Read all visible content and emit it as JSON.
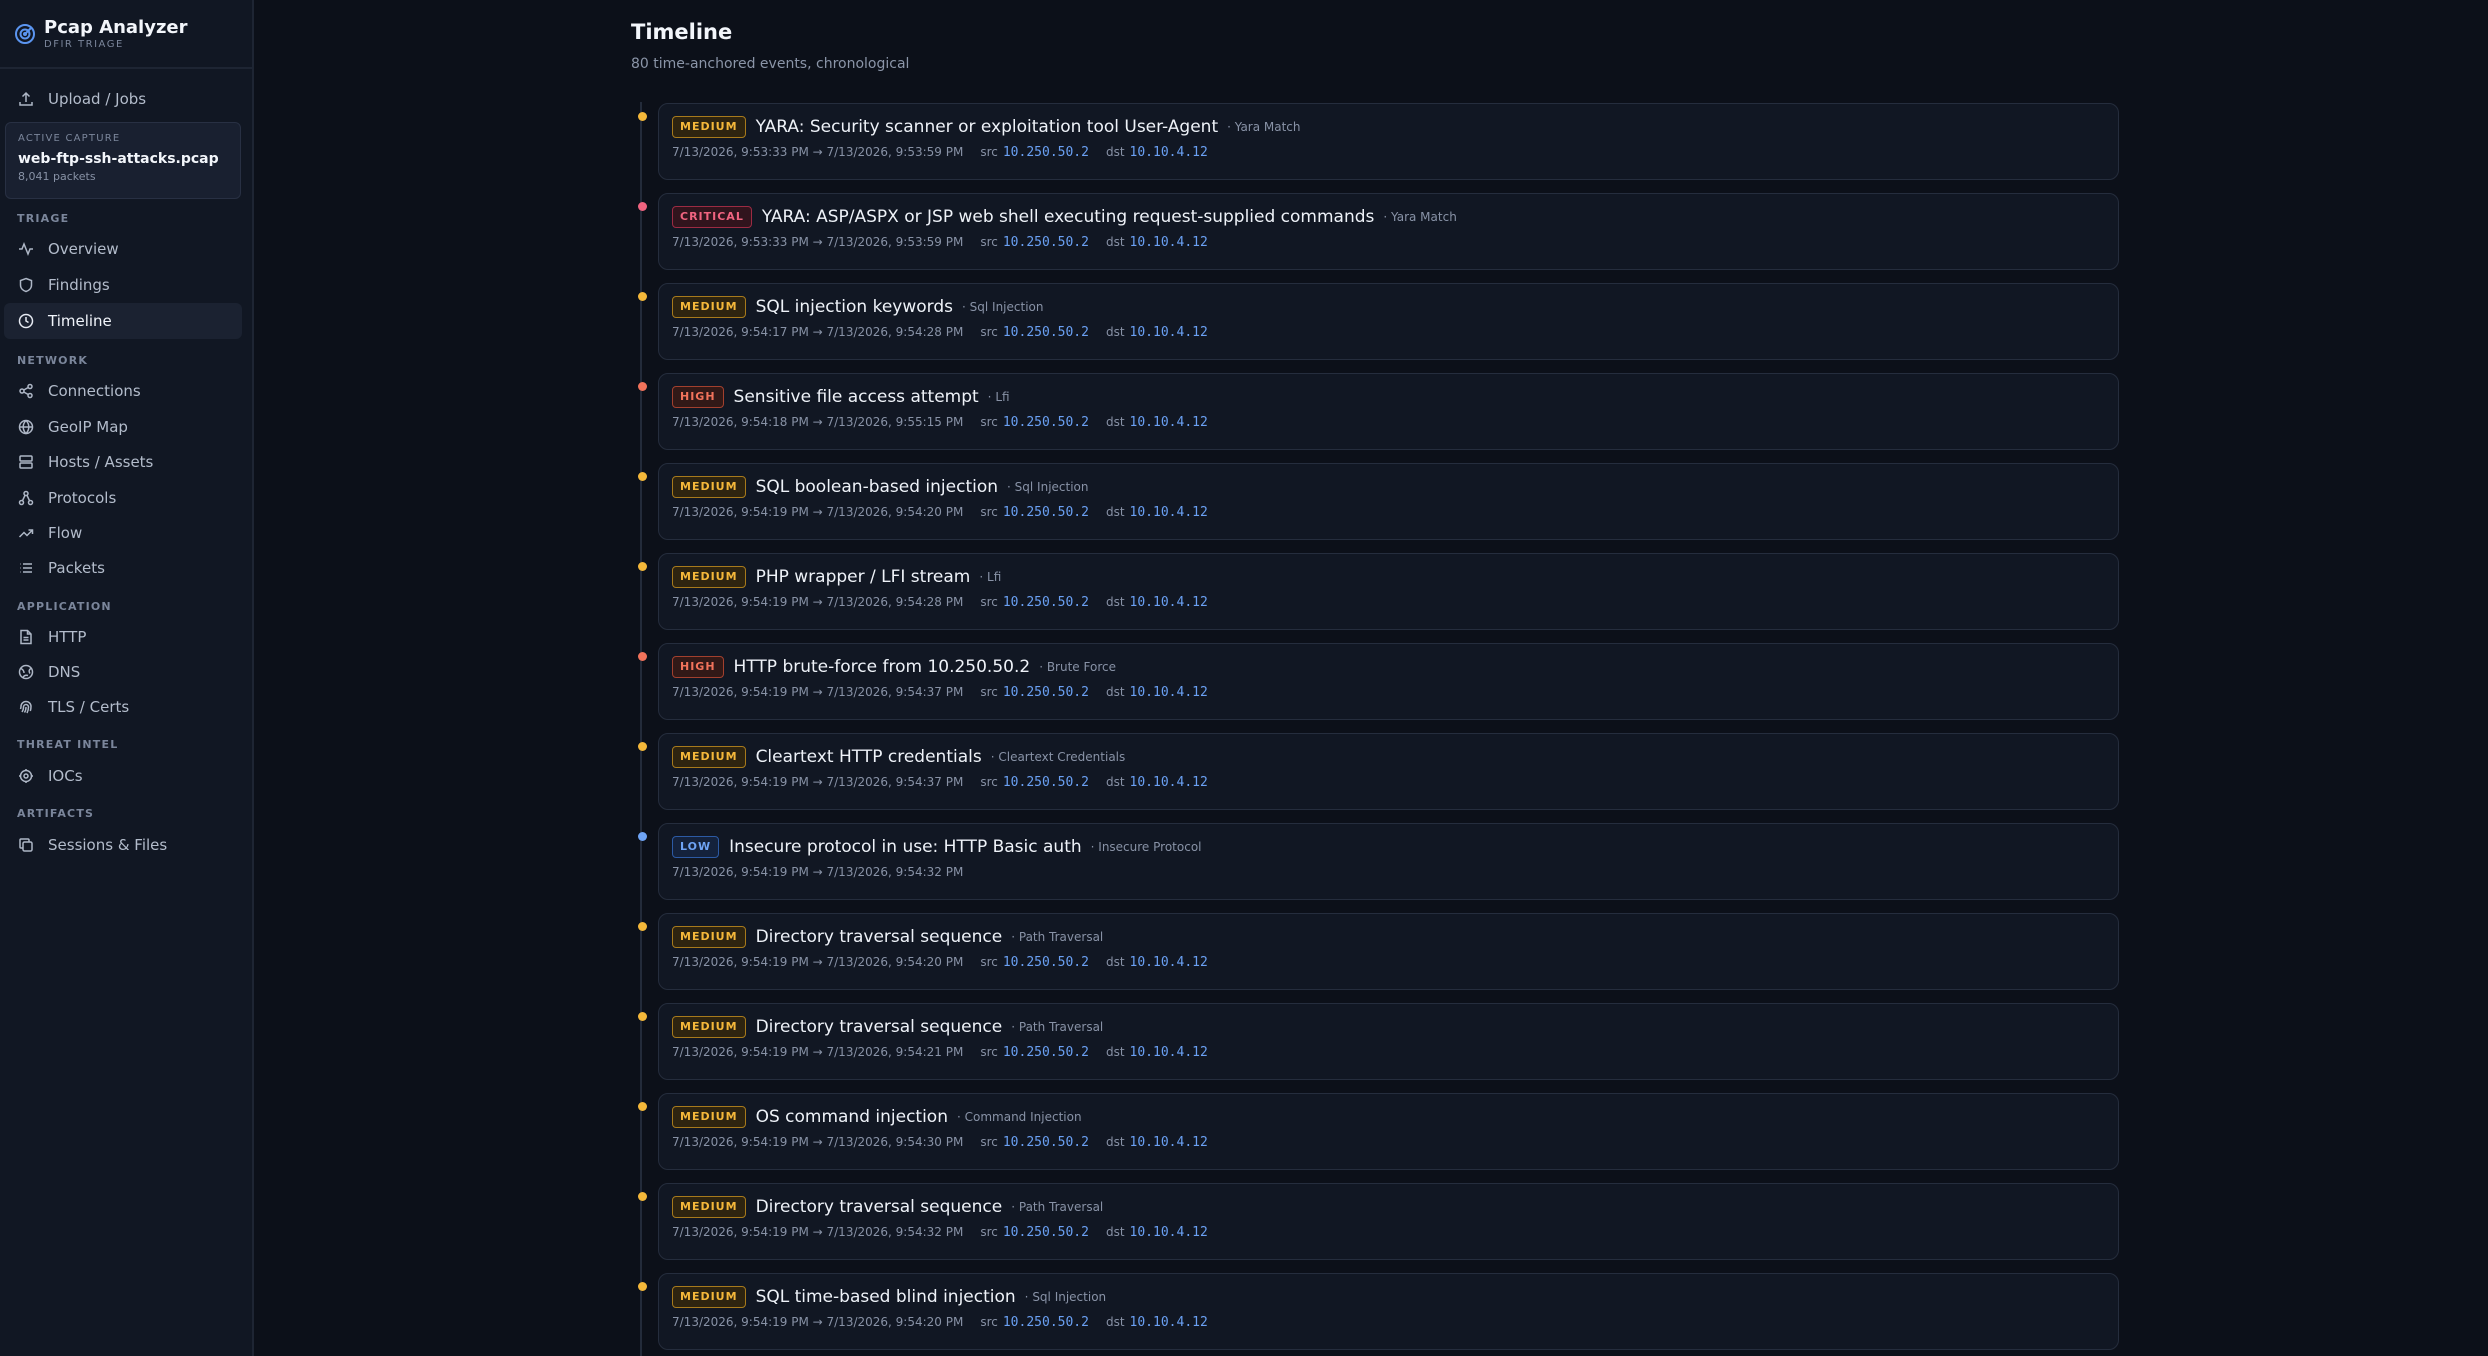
{
  "app": {
    "name": "Pcap Analyzer",
    "subtitle": "DFIR TRIAGE"
  },
  "sidebar": {
    "upload": {
      "label": "Upload / Jobs",
      "icon": "upload-icon"
    },
    "active_capture": {
      "label": "ACTIVE CAPTURE",
      "file": "web-ftp-ssh-attacks.pcap",
      "packets": "8,041 packets"
    },
    "sections": [
      {
        "label": "TRIAGE",
        "items": [
          {
            "label": "Overview",
            "icon": "activity-icon"
          },
          {
            "label": "Findings",
            "icon": "shield-icon"
          },
          {
            "label": "Timeline",
            "icon": "clock-icon",
            "active": true
          }
        ]
      },
      {
        "label": "NETWORK",
        "items": [
          {
            "label": "Connections",
            "icon": "share-icon"
          },
          {
            "label": "GeoIP Map",
            "icon": "globe-icon"
          },
          {
            "label": "Hosts / Assets",
            "icon": "server-icon"
          },
          {
            "label": "Protocols",
            "icon": "protocols-icon"
          },
          {
            "label": "Flow",
            "icon": "trend-icon"
          },
          {
            "label": "Packets",
            "icon": "list-icon"
          }
        ]
      },
      {
        "label": "APPLICATION",
        "items": [
          {
            "label": "HTTP",
            "icon": "file-icon"
          },
          {
            "label": "DNS",
            "icon": "dns-icon"
          },
          {
            "label": "TLS / Certs",
            "icon": "fingerprint-icon"
          }
        ]
      },
      {
        "label": "THREAT INTEL",
        "items": [
          {
            "label": "IOCs",
            "icon": "ioc-icon"
          }
        ]
      },
      {
        "label": "ARTIFACTS",
        "items": [
          {
            "label": "Sessions & Files",
            "icon": "copy-icon"
          }
        ]
      }
    ]
  },
  "main": {
    "title": "Timeline",
    "subtitle": "80 time-anchored events, chronological",
    "src_label": "src",
    "dst_label": "dst",
    "severity_colors": {
      "MEDIUM": "#f5b83a",
      "CRITICAL": "#f06480",
      "HIGH": "#f2735b",
      "LOW": "#6fa4f5"
    },
    "events": [
      {
        "severity": "MEDIUM",
        "title": "YARA: Security scanner or exploitation tool User-Agent",
        "category": "Yara Match",
        "time": "7/13/2026, 9:53:33 PM → 7/13/2026, 9:53:59 PM",
        "src": "10.250.50.2",
        "dst": "10.10.4.12"
      },
      {
        "severity": "CRITICAL",
        "title": "YARA: ASP/ASPX or JSP web shell executing request-supplied commands",
        "category": "Yara Match",
        "time": "7/13/2026, 9:53:33 PM → 7/13/2026, 9:53:59 PM",
        "src": "10.250.50.2",
        "dst": "10.10.4.12"
      },
      {
        "severity": "MEDIUM",
        "title": "SQL injection keywords",
        "category": "Sql Injection",
        "time": "7/13/2026, 9:54:17 PM → 7/13/2026, 9:54:28 PM",
        "src": "10.250.50.2",
        "dst": "10.10.4.12"
      },
      {
        "severity": "HIGH",
        "title": "Sensitive file access attempt",
        "category": "Lfi",
        "time": "7/13/2026, 9:54:18 PM → 7/13/2026, 9:55:15 PM",
        "src": "10.250.50.2",
        "dst": "10.10.4.12"
      },
      {
        "severity": "MEDIUM",
        "title": "SQL boolean-based injection",
        "category": "Sql Injection",
        "time": "7/13/2026, 9:54:19 PM → 7/13/2026, 9:54:20 PM",
        "src": "10.250.50.2",
        "dst": "10.10.4.12"
      },
      {
        "severity": "MEDIUM",
        "title": "PHP wrapper / LFI stream",
        "category": "Lfi",
        "time": "7/13/2026, 9:54:19 PM → 7/13/2026, 9:54:28 PM",
        "src": "10.250.50.2",
        "dst": "10.10.4.12"
      },
      {
        "severity": "HIGH",
        "title": "HTTP brute-force from 10.250.50.2",
        "category": "Brute Force",
        "time": "7/13/2026, 9:54:19 PM → 7/13/2026, 9:54:37 PM",
        "src": "10.250.50.2",
        "dst": "10.10.4.12"
      },
      {
        "severity": "MEDIUM",
        "title": "Cleartext HTTP credentials",
        "category": "Cleartext Credentials",
        "time": "7/13/2026, 9:54:19 PM → 7/13/2026, 9:54:37 PM",
        "src": "10.250.50.2",
        "dst": "10.10.4.12"
      },
      {
        "severity": "LOW",
        "title": "Insecure protocol in use: HTTP Basic auth",
        "category": "Insecure Protocol",
        "time": "7/13/2026, 9:54:19 PM → 7/13/2026, 9:54:32 PM",
        "src": "",
        "dst": ""
      },
      {
        "severity": "MEDIUM",
        "title": "Directory traversal sequence",
        "category": "Path Traversal",
        "time": "7/13/2026, 9:54:19 PM → 7/13/2026, 9:54:20 PM",
        "src": "10.250.50.2",
        "dst": "10.10.4.12"
      },
      {
        "severity": "MEDIUM",
        "title": "Directory traversal sequence",
        "category": "Path Traversal",
        "time": "7/13/2026, 9:54:19 PM → 7/13/2026, 9:54:21 PM",
        "src": "10.250.50.2",
        "dst": "10.10.4.12"
      },
      {
        "severity": "MEDIUM",
        "title": "OS command injection",
        "category": "Command Injection",
        "time": "7/13/2026, 9:54:19 PM → 7/13/2026, 9:54:30 PM",
        "src": "10.250.50.2",
        "dst": "10.10.4.12"
      },
      {
        "severity": "MEDIUM",
        "title": "Directory traversal sequence",
        "category": "Path Traversal",
        "time": "7/13/2026, 9:54:19 PM → 7/13/2026, 9:54:32 PM",
        "src": "10.250.50.2",
        "dst": "10.10.4.12"
      },
      {
        "severity": "MEDIUM",
        "title": "SQL time-based blind injection",
        "category": "Sql Injection",
        "time": "7/13/2026, 9:54:19 PM → 7/13/2026, 9:54:20 PM",
        "src": "10.250.50.2",
        "dst": "10.10.4.12"
      }
    ]
  }
}
